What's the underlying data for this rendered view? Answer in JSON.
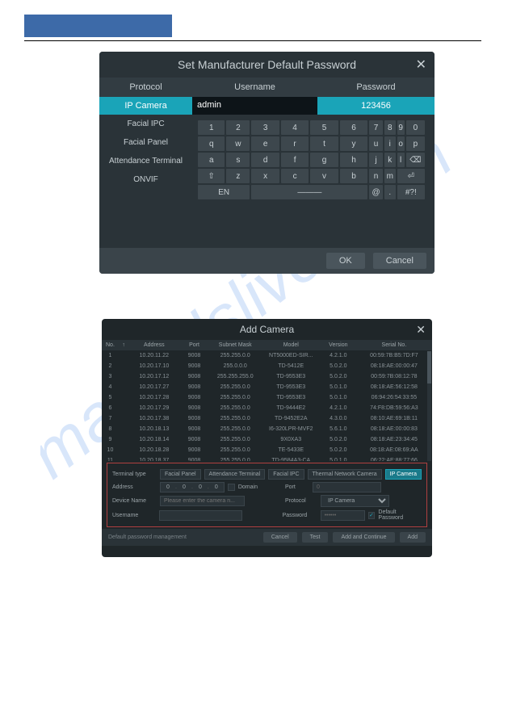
{
  "dlg1": {
    "title": "Set Manufacturer Default Password",
    "cols": {
      "protocol": "Protocol",
      "username": "Username",
      "password": "Password"
    },
    "selected": {
      "protocol": "IP Camera",
      "username": "admin",
      "password": "123456"
    },
    "protocols": [
      "Facial IPC",
      "Facial Panel",
      "Attendance Terminal",
      "ONVIF"
    ],
    "keyboard": {
      "row1": [
        "1",
        "2",
        "3",
        "4",
        "5",
        "6",
        "7",
        "8",
        "9",
        "0"
      ],
      "row2": [
        "q",
        "w",
        "e",
        "r",
        "t",
        "y",
        "u",
        "i",
        "o",
        "p"
      ],
      "row3": [
        "a",
        "s",
        "d",
        "f",
        "g",
        "h",
        "j",
        "k",
        "l",
        "←"
      ],
      "row4": [
        "⇧",
        "z",
        "x",
        "c",
        "v",
        "b",
        "n",
        "m",
        "⏎"
      ],
      "row5": [
        "EN",
        "———",
        "@",
        ".",
        "#?!"
      ]
    },
    "ok": "OK",
    "cancel": "Cancel"
  },
  "dlg2": {
    "title": "Add Camera",
    "cols": {
      "no": "No.",
      "arrow": "↑",
      "addr": "Address",
      "port": "Port",
      "mask": "Subnet Mask",
      "model": "Model",
      "ver": "Version",
      "sn": "Serial No."
    },
    "rows": [
      {
        "no": "1",
        "addr": "10.20.11.22",
        "port": "9008",
        "mask": "255.255.0.0",
        "model": "NT5000ED-SIR...",
        "ver": "4.2.1.0",
        "sn": "00:59:7B:B5:7D:F7"
      },
      {
        "no": "2",
        "addr": "10.20.17.10",
        "port": "9008",
        "mask": "255.0.0.0",
        "model": "TD-5412E",
        "ver": "5.0.2.0",
        "sn": "08:18:AE:00:00:47"
      },
      {
        "no": "3",
        "addr": "10.20.17.12",
        "port": "9008",
        "mask": "255.255.255.0",
        "model": "TD-9553E3",
        "ver": "5.0.2.0",
        "sn": "00:59:7B:08:12:78"
      },
      {
        "no": "4",
        "addr": "10.20.17.27",
        "port": "9008",
        "mask": "255.255.0.0",
        "model": "TD-9553E3",
        "ver": "5.0.1.0",
        "sn": "08:18:AE:56:12:58"
      },
      {
        "no": "5",
        "addr": "10.20.17.28",
        "port": "9008",
        "mask": "255.255.0.0",
        "model": "TD-9553E3",
        "ver": "5.0.1.0",
        "sn": "06:94:26:54:33:55"
      },
      {
        "no": "6",
        "addr": "10.20.17.29",
        "port": "9008",
        "mask": "255.255.0.0",
        "model": "TD-9444E2",
        "ver": "4.2.1.0",
        "sn": "74:F8:DB:59:56:A3"
      },
      {
        "no": "7",
        "addr": "10.20.17.38",
        "port": "9008",
        "mask": "255.255.0.0",
        "model": "TD-9452E2A",
        "ver": "4.3.0.0",
        "sn": "08:10:AE:69:1B:11"
      },
      {
        "no": "8",
        "addr": "10.20.18.13",
        "port": "9008",
        "mask": "255.255.0.0",
        "model": "I6-320LPR-MVF2",
        "ver": "5.6.1.0",
        "sn": "08:18:AE:00:00:83"
      },
      {
        "no": "9",
        "addr": "10.20.18.14",
        "port": "9008",
        "mask": "255.255.0.0",
        "model": "9X0XA3",
        "ver": "5.0.2.0",
        "sn": "08:18:AE:23:34:45"
      },
      {
        "no": "10",
        "addr": "10.20.18.28",
        "port": "9008",
        "mask": "255.255.0.0",
        "model": "TE-5433E",
        "ver": "5.0.2.0",
        "sn": "08:18:AE:08:69:AA"
      },
      {
        "no": "11",
        "addr": "10.20.18.37",
        "port": "9008",
        "mask": "255.255.0.0",
        "model": "TD-9584A3-CA",
        "ver": "5.0.1.0",
        "sn": "06:22:AE:88:77:66"
      }
    ],
    "form": {
      "terminal_type_label": "Terminal type",
      "terminals": [
        "Facial Panel",
        "Attendance Terminal",
        "Facial IPC",
        "Thermal Network Camera",
        "IP Camera"
      ],
      "address_label": "Address",
      "ip": [
        "0",
        "0",
        "0",
        "0"
      ],
      "domain_label": "Domain",
      "port_label": "Port",
      "port_value": "0",
      "device_name_label": "Device Name",
      "device_name_placeholder": "Please enter the camera n...",
      "protocol_label": "Protocol",
      "protocol_value": "IP Camera",
      "username_label": "Username",
      "username_value": "",
      "password_label": "Password",
      "password_value": "••••••",
      "default_pw_label": "Default Password"
    },
    "footer": {
      "pw_mgmt": "Default password management",
      "cancel": "Cancel",
      "test": "Test",
      "add_continue": "Add and Continue",
      "add": "Add"
    }
  }
}
